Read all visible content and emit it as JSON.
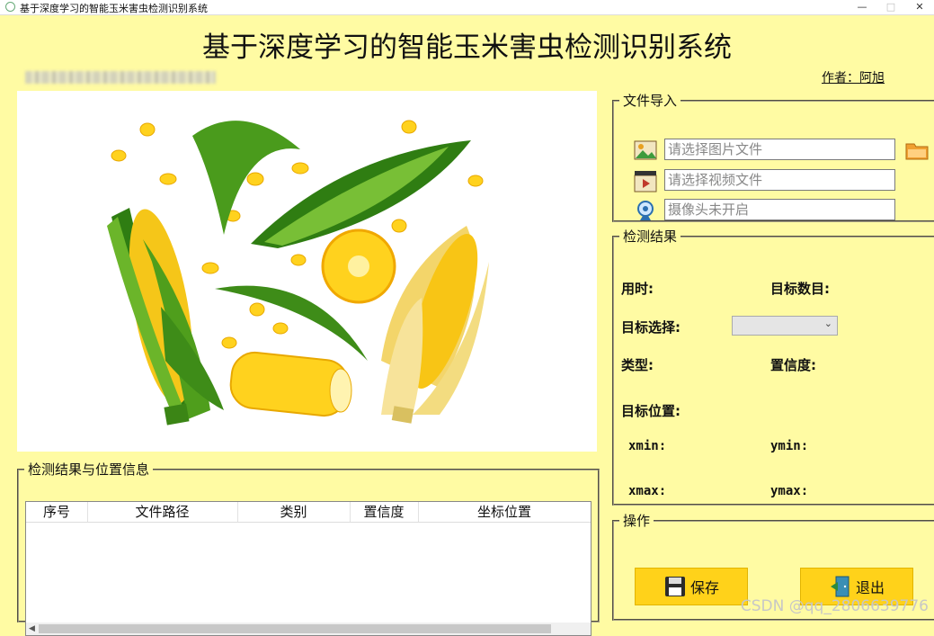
{
  "window": {
    "title": "基于深度学习的智能玉米害虫检测识别系统",
    "minimize": "—",
    "maximize": "□",
    "close": "✕"
  },
  "header": {
    "title": "基于深度学习的智能玉米害虫检测识别系统",
    "author": "作者：阿旭"
  },
  "file_import": {
    "legend": "文件导入",
    "image_placeholder": "请选择图片文件",
    "video_placeholder": "请选择视频文件",
    "camera_placeholder": "摄像头未开启"
  },
  "results": {
    "legend": "检测结果",
    "time_label": "用时:",
    "count_label": "目标数目:",
    "select_label": "目标选择:",
    "type_label": "类型:",
    "conf_label": "置信度:",
    "pos_label": "目标位置:",
    "xmin": "xmin:",
    "ymin": "ymin:",
    "xmax": "xmax:",
    "ymax": "ymax:"
  },
  "ops": {
    "legend": "操作",
    "save": "保存",
    "exit": "退出"
  },
  "table": {
    "legend": "检测结果与位置信息",
    "columns": [
      "序号",
      "文件路径",
      "类别",
      "置信度",
      "坐标位置"
    ]
  },
  "watermark": "CSDN @qq_2806639776",
  "colors": {
    "background": "#fffba3",
    "button": "#ffd21a"
  }
}
